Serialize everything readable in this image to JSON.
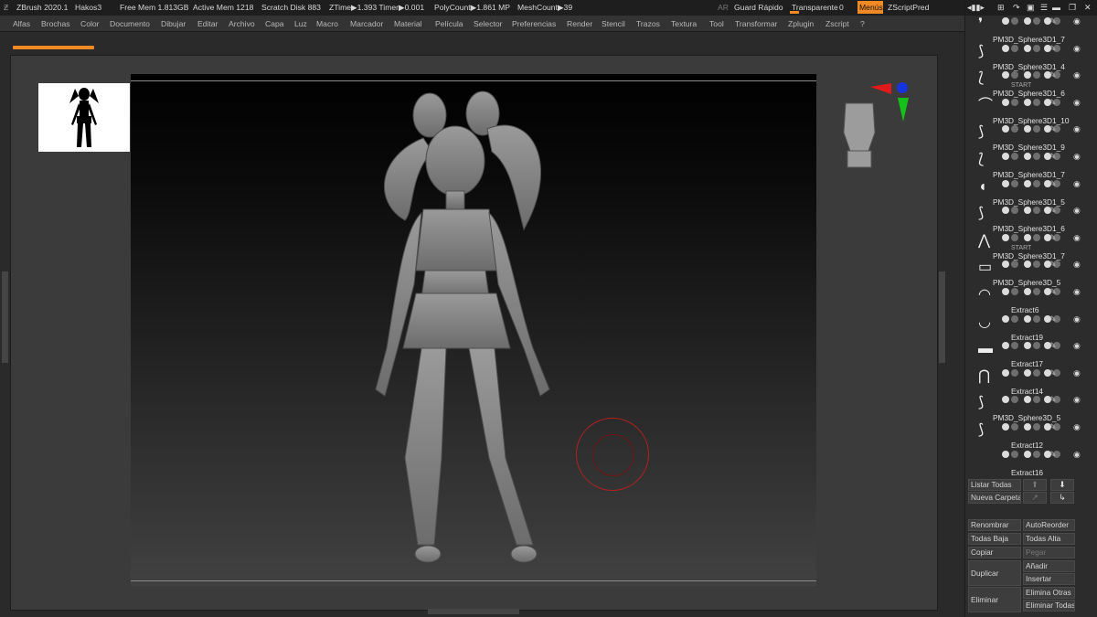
{
  "titlebar": {
    "app": "ZBrush 2020.1",
    "file": "Hakos3",
    "free_mem": "Free Mem 1.813GB",
    "active_mem": "Active Mem 1218",
    "scratch_disk": "Scratch Disk 883",
    "ztime": "ZTime▶1.393 Timer▶0.001",
    "polycount": "PolyCount▶1.861 MP",
    "meshcount": "MeshCount▶39",
    "ar": "AR",
    "quicksave": "Guard Rápido",
    "transparent_label": "Transparente",
    "transparent_value": "0",
    "menus_button": "Menús",
    "zscript": "ZScriptPred"
  },
  "menu_items": [
    "Alfas",
    "Brochas",
    "Color",
    "Documento",
    "Dibujar",
    "Editar",
    "Archivo",
    "Capa",
    "Luz",
    "Macro",
    "Marcador",
    "Material",
    "Película",
    "Selector",
    "Preferencias",
    "Render",
    "Stencil",
    "Trazos",
    "Textura",
    "Tool",
    "Transformar",
    "Zplugin",
    "Zscript",
    "?"
  ],
  "subtools": [
    {
      "name": "PM3D_Sphere3D1_7",
      "thumb": "❜"
    },
    {
      "name": "PM3D_Sphere3D1_4",
      "thumb": "⟆"
    },
    {
      "name": "PM3D_Sphere3D1_6",
      "thumb": "⟅",
      "extra": "START"
    },
    {
      "name": "PM3D_Sphere3D1_10",
      "thumb": "⌒"
    },
    {
      "name": "PM3D_Sphere3D1_9",
      "thumb": "⟆"
    },
    {
      "name": "PM3D_Sphere3D1_7",
      "thumb": "⟅"
    },
    {
      "name": "PM3D_Sphere3D1_5",
      "thumb": "◖"
    },
    {
      "name": "PM3D_Sphere3D1_6",
      "thumb": "⟆"
    },
    {
      "name": "PM3D_Sphere3D1_7",
      "thumb": "⋀",
      "extra": "START"
    },
    {
      "name": "PM3D_Sphere3D_5",
      "thumb": "▭"
    },
    {
      "name": "Extract6",
      "thumb": "◠"
    },
    {
      "name": "Extract19",
      "thumb": "◡"
    },
    {
      "name": "Extract17",
      "thumb": "▬"
    },
    {
      "name": "Extract14",
      "thumb": "⋂"
    },
    {
      "name": "PM3D_Sphere3D_5",
      "thumb": "⟆"
    },
    {
      "name": "Extract12",
      "thumb": "⟆"
    },
    {
      "name": "Extract16",
      "thumb": ""
    }
  ],
  "panel_buttons": {
    "list_all": "Listar Todas",
    "new_folder": "Nueva Carpeta",
    "rename": "Renombrar",
    "autoreorder": "AutoReorder",
    "all_low": "Todas Baja",
    "all_high": "Todas Alta",
    "copy": "Copiar",
    "paste": "Pegar",
    "duplicate": "Duplicar",
    "add": "Añadir",
    "insert": "Insertar",
    "delete": "Eliminar",
    "delete_other": "Elimina Otras",
    "delete_all": "Eliminar Todas"
  },
  "colors": {
    "accent": "#f08a24",
    "bg": "#2a2a2a",
    "panel": "#2c2c2c"
  }
}
